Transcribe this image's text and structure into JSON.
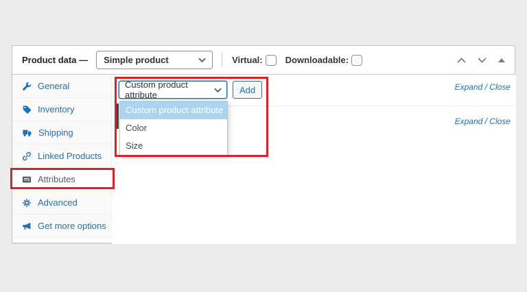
{
  "colors": {
    "accent_blue": "#2271b1",
    "annotation_red": "#df1f26",
    "option_highlight_blue": "#a9d5f0",
    "active_tab_text": "#555d66"
  },
  "metabox": {
    "title": "Product data —",
    "product_type_select": {
      "value": "Simple product"
    },
    "virtual_label": "Virtual:",
    "virtual_checked": false,
    "downloadable_label": "Downloadable:",
    "downloadable_checked": false
  },
  "tabs": [
    {
      "label": "General",
      "icon": "wrench-icon",
      "active": false
    },
    {
      "label": "Inventory",
      "icon": "tag-icon",
      "active": false
    },
    {
      "label": "Shipping",
      "icon": "truck-icon",
      "active": false
    },
    {
      "label": "Linked Products",
      "icon": "link-icon",
      "active": false
    },
    {
      "label": "Attributes",
      "icon": "list-card-icon",
      "active": true
    },
    {
      "label": "Advanced",
      "icon": "gear-icon",
      "active": false
    },
    {
      "label": "Get more options",
      "icon": "megaphone-icon",
      "active": false
    }
  ],
  "attributes_panel": {
    "attribute_select": {
      "value": "Custom product attribute",
      "options": [
        "Custom product attribute",
        "Color",
        "Size"
      ],
      "highlighted_option": "Custom product attribute"
    },
    "add_button_label": "Add",
    "toolbar_expand_close": "Expand / Close",
    "attribute_row_expand_close": "Expand / Close"
  }
}
